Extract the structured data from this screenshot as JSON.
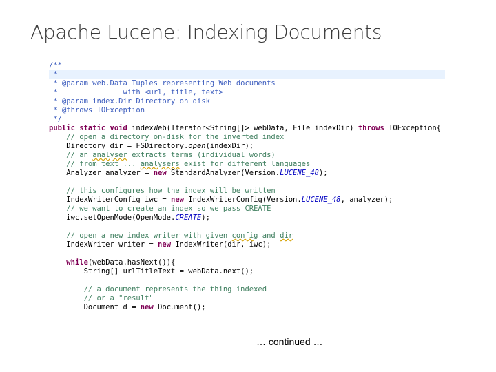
{
  "slide": {
    "title": "Apache Lucene: Indexing Documents",
    "footer": "… continued …"
  },
  "code": {
    "highlighted_line": 1,
    "lines": [
      [
        {
          "t": "/**",
          "c": "cm"
        }
      ],
      [
        {
          "t": " *",
          "c": "cm"
        }
      ],
      [
        {
          "t": " * @param web.Data Tuples representing Web documents",
          "c": "cm"
        }
      ],
      [
        {
          "t": " *               with <url, title, text>",
          "c": "cm"
        }
      ],
      [
        {
          "t": " * @param index.Dir Directory on disk",
          "c": "cm"
        }
      ],
      [
        {
          "t": " * @throws IOException",
          "c": "cm"
        }
      ],
      [
        {
          "t": " */",
          "c": "cm"
        }
      ],
      [
        {
          "t": "public static void ",
          "c": "kw"
        },
        {
          "t": "indexWeb(Iterator<String[]> webData, File indexDir) "
        },
        {
          "t": "throws ",
          "c": "kw"
        },
        {
          "t": "IOException{"
        }
      ],
      [
        {
          "t": "    // open a directory on-disk for the inverted index",
          "c": "c"
        }
      ],
      [
        {
          "t": "    Directory dir = FSDirectory."
        },
        {
          "t": "open",
          "c": "it"
        },
        {
          "t": "(indexDir);"
        }
      ],
      [
        {
          "t": "    // an ",
          "c": "c"
        },
        {
          "t": "analyser",
          "c": "c sp"
        },
        {
          "t": " extracts terms (individual words)",
          "c": "c"
        }
      ],
      [
        {
          "t": "    // from text ... ",
          "c": "c"
        },
        {
          "t": "analysers",
          "c": "c sp"
        },
        {
          "t": " exist for different languages",
          "c": "c"
        }
      ],
      [
        {
          "t": "    Analyzer analyzer = "
        },
        {
          "t": "new ",
          "c": "kw"
        },
        {
          "t": "StandardAnalyzer(Version."
        },
        {
          "t": "LUCENE_48",
          "c": "fi"
        },
        {
          "t": ");"
        }
      ],
      [
        {
          "t": ""
        }
      ],
      [
        {
          "t": "    // this configures how the index will be written",
          "c": "c"
        }
      ],
      [
        {
          "t": "    IndexWriterConfig iwc = "
        },
        {
          "t": "new ",
          "c": "kw"
        },
        {
          "t": "IndexWriterConfig(Version."
        },
        {
          "t": "LUCENE_48",
          "c": "fi"
        },
        {
          "t": ", analyzer);"
        }
      ],
      [
        {
          "t": "    // we want to create an index so we pass CREATE",
          "c": "c"
        }
      ],
      [
        {
          "t": "    iwc.setOpenMode(OpenMode."
        },
        {
          "t": "CREATE",
          "c": "fi"
        },
        {
          "t": ");"
        }
      ],
      [
        {
          "t": ""
        }
      ],
      [
        {
          "t": "    // open a new index writer with given ",
          "c": "c"
        },
        {
          "t": "config",
          "c": "c sp"
        },
        {
          "t": " and ",
          "c": "c"
        },
        {
          "t": "dir",
          "c": "c sp"
        }
      ],
      [
        {
          "t": "    IndexWriter writer = "
        },
        {
          "t": "new ",
          "c": "kw"
        },
        {
          "t": "IndexWriter(dir, iwc);"
        }
      ],
      [
        {
          "t": ""
        }
      ],
      [
        {
          "t": "    "
        },
        {
          "t": "while",
          "c": "kw"
        },
        {
          "t": "(webData.hasNext()){"
        }
      ],
      [
        {
          "t": "        String[] urlTitleText = webData.next();"
        }
      ],
      [
        {
          "t": ""
        }
      ],
      [
        {
          "t": "        // a document represents the thing indexed",
          "c": "c"
        }
      ],
      [
        {
          "t": "        // or a \"result\"",
          "c": "c"
        }
      ],
      [
        {
          "t": "        Document d = "
        },
        {
          "t": "new ",
          "c": "kw"
        },
        {
          "t": "Document();"
        }
      ]
    ]
  }
}
